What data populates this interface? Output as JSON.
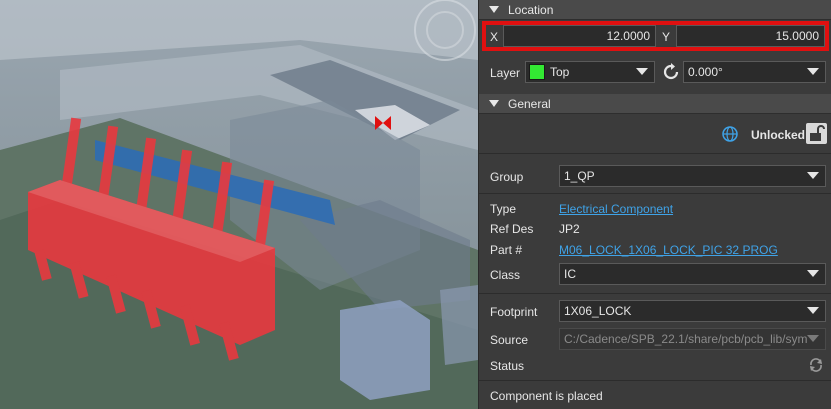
{
  "location": {
    "title": "Location",
    "x_label": "X",
    "x_value": "12.0000",
    "y_label": "Y",
    "y_value": "15.0000",
    "layer_label": "Layer",
    "layer_value": "Top",
    "layer_color": "#33e833",
    "rotation_value": "0.000°"
  },
  "general": {
    "title": "General",
    "lock_status": "Unlocked",
    "group_label": "Group",
    "group_value": "1_QP",
    "type_label": "Type",
    "type_value": "Electrical Component",
    "refdes_label": "Ref Des",
    "refdes_value": "JP2",
    "part_label": "Part #",
    "part_value": "M06_LOCK_1X06_LOCK_PIC 32 PROG",
    "class_label": "Class",
    "class_value": "IC",
    "footprint_label": "Footprint",
    "footprint_value": "1X06_LOCK",
    "source_label": "Source",
    "source_value": "C:/Cadence/SPB_22.1/share/pcb/pcb_lib/sym",
    "status_label": "Status",
    "placed_text": "Component is placed"
  },
  "colors": {
    "highlight": "#e01010",
    "link": "#3fa3e8",
    "component": "#e8393f"
  }
}
